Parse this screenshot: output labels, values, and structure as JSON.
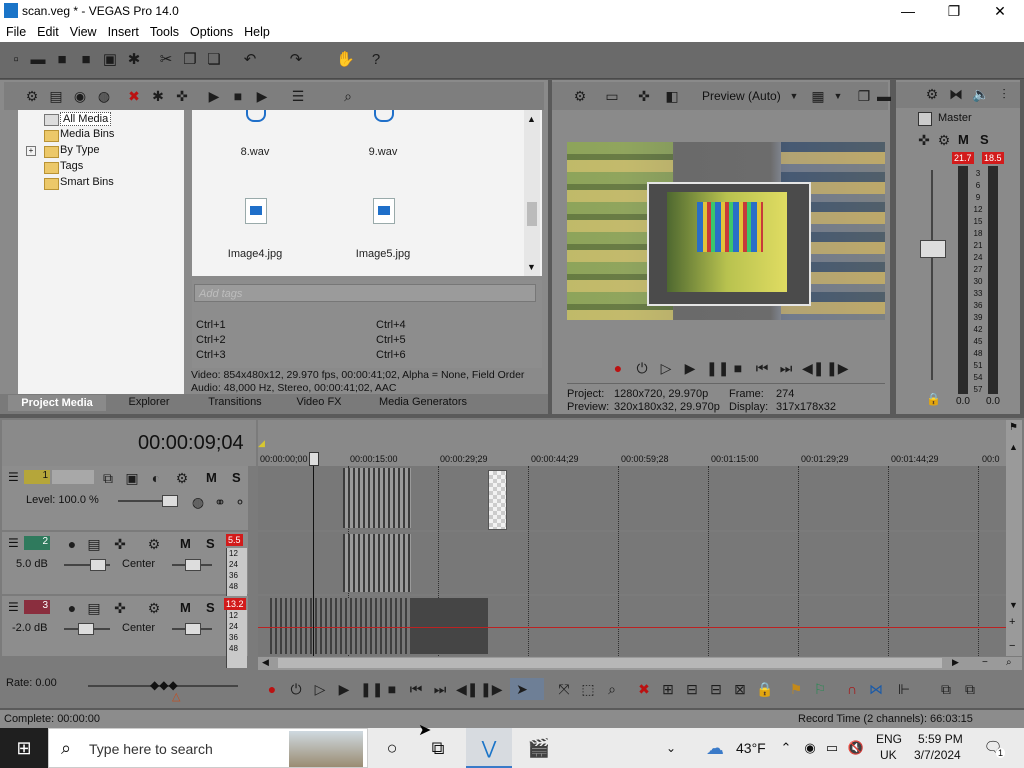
{
  "window": {
    "title": "scan.veg * - VEGAS Pro 14.0",
    "minimize": "—",
    "maximize": "❐",
    "close": "✕"
  },
  "menu": [
    "File",
    "Edit",
    "View",
    "Insert",
    "Tools",
    "Options",
    "Help"
  ],
  "explorer": {
    "tree": [
      "All Media",
      "Media Bins",
      "By Type",
      "Tags",
      "Smart Bins"
    ],
    "files": [
      "8.wav",
      "9.wav",
      "Image4.jpg",
      "Image5.jpg"
    ],
    "tags_placeholder": "Add tags",
    "shortcuts_left": [
      "Ctrl+1",
      "Ctrl+2",
      "Ctrl+3"
    ],
    "shortcuts_right": [
      "Ctrl+4",
      "Ctrl+5",
      "Ctrl+6"
    ],
    "info_video": "Video: 854x480x12, 29.970 fps, 00:00:41;02, Alpha = None, Field Order",
    "info_audio": "Audio: 48,000 Hz, Stereo, 00:00:41;02, AAC",
    "tabs": [
      "Project Media",
      "Explorer",
      "Transitions",
      "Video FX",
      "Media Generators"
    ]
  },
  "preview": {
    "mode": "Preview (Auto)",
    "project_label": "Project:",
    "project_value": "1280x720, 29.970p",
    "preview_label": "Preview:",
    "preview_value": "320x180x32, 29.970p",
    "frame_label": "Frame:",
    "frame_value": "274",
    "display_label": "Display:",
    "display_value": "317x178x32"
  },
  "master": {
    "label": "Master",
    "m": "M",
    "s": "S",
    "peak_left": "21.7",
    "peak_right": "18.5",
    "scale": [
      "3",
      "6",
      "9",
      "12",
      "15",
      "18",
      "21",
      "24",
      "27",
      "30",
      "33",
      "36",
      "39",
      "42",
      "45",
      "48",
      "51",
      "54",
      "57"
    ],
    "bottom_left": "0.0",
    "bottom_right": "0.0"
  },
  "timeline": {
    "timecode": "00:00:09;04",
    "ruler": [
      "00:00:00;00",
      "00:00:15:00",
      "00:00:29;29",
      "00:00:44;29",
      "00:00:59;28",
      "00:01:15:00",
      "00:01:29;29",
      "00:01:44;29",
      "00:0"
    ],
    "rate": "Rate: 0.00"
  },
  "tracks": [
    {
      "num": "1",
      "level": "Level: 100.0 %",
      "m": "M",
      "s": "S"
    },
    {
      "num": "2",
      "vol": "5.0 dB",
      "pan": "Center",
      "m": "M",
      "s": "S",
      "peak": "5.5"
    },
    {
      "num": "3",
      "vol": "-2.0 dB",
      "pan": "Center",
      "m": "M",
      "s": "S",
      "peak": "13.2"
    }
  ],
  "vol_scale": [
    "12",
    "24",
    "36",
    "48"
  ],
  "status": {
    "left": "Complete: 00:00:00",
    "right": "Record Time (2 channels): 66:03:15"
  },
  "taskbar": {
    "search": "Type here to search",
    "weather": "43°F",
    "lang1": "ENG",
    "lang2": "UK",
    "time": "5:59 PM",
    "date": "3/7/2024",
    "notif": "1"
  }
}
